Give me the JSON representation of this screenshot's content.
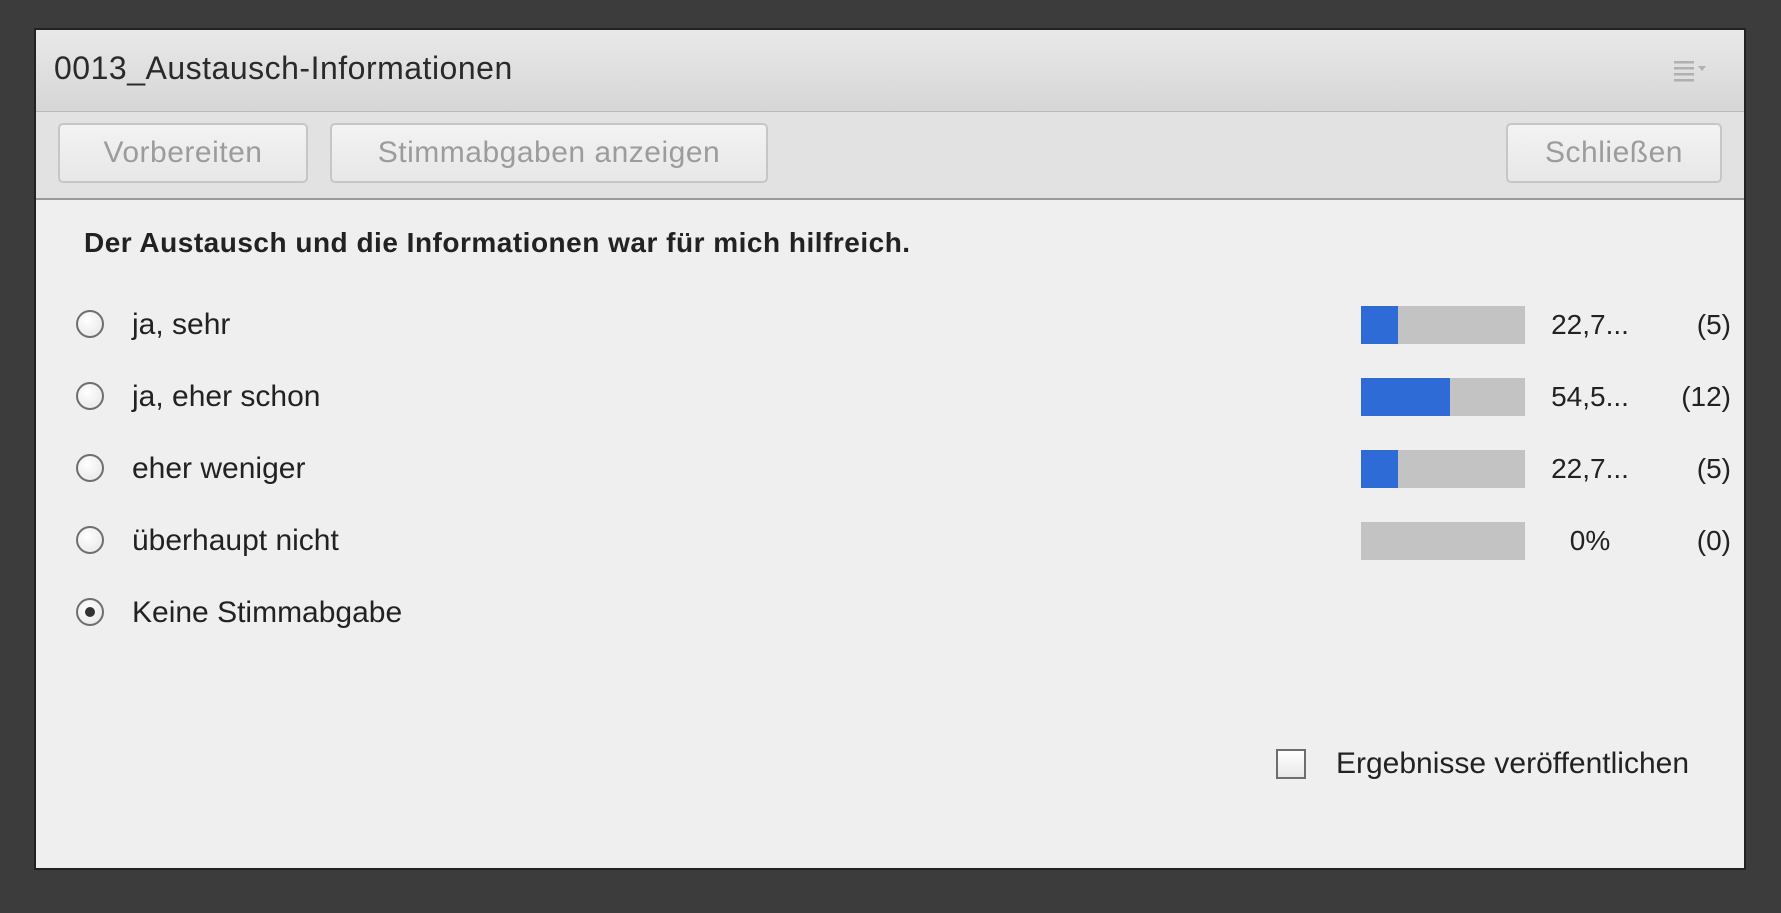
{
  "pod": {
    "title": "0013_Austausch-Informationen",
    "menu_icon": "list-menu-icon"
  },
  "toolbar": {
    "prepare_label": "Vorbereiten",
    "show_votes_label": "Stimmabgaben anzeigen",
    "close_label": "Schließen"
  },
  "poll": {
    "question": "Der Austausch und die Informationen war für mich hilfreich.",
    "options": [
      {
        "label": "ja, sehr",
        "percent": "22,7...",
        "count": "(5)",
        "fraction": 0.227,
        "selected": false
      },
      {
        "label": "ja, eher schon",
        "percent": "54,5...",
        "count": "(12)",
        "fraction": 0.545,
        "selected": false
      },
      {
        "label": "eher weniger",
        "percent": "22,7...",
        "count": "(5)",
        "fraction": 0.227,
        "selected": false
      },
      {
        "label": "überhaupt nicht",
        "percent": "0%",
        "count": "(0)",
        "fraction": 0,
        "selected": false
      },
      {
        "label": "Keine Stimmabgabe",
        "selected": true
      }
    ],
    "publish_label": "Ergebnisse veröffentlichen",
    "publish_checked": false
  },
  "colors": {
    "bar_fill": "#2f6bd6",
    "bar_track": "#c3c3c3"
  }
}
